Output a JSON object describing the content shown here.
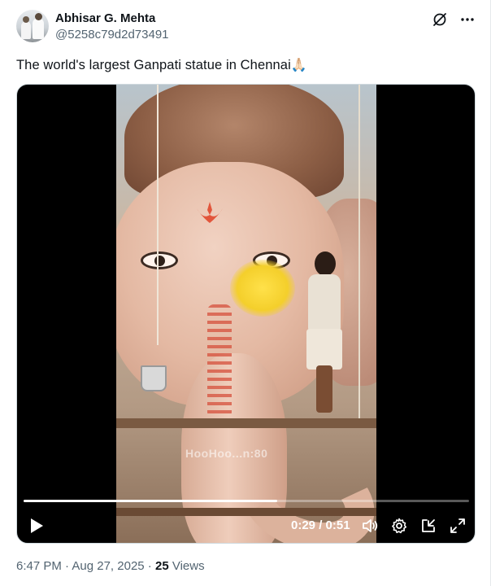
{
  "author": {
    "name": "Abhisar G. Mehta",
    "handle": "@5258c79d2d73491"
  },
  "tweet": {
    "text": "The world's largest Ganpati statue in Chennai",
    "emoji": "🙏🏻"
  },
  "video": {
    "watermark": "HooHoo...n:80",
    "current_time": "0:29",
    "separator": " / ",
    "duration": "0:51",
    "progress": 0.57
  },
  "footer": {
    "time": "6:47 PM",
    "dot1": " · ",
    "date": "Aug 27, 2025",
    "dot2": " · ",
    "views_count": "25",
    "views_label": " Views"
  },
  "icons": {
    "grok": "grok-icon",
    "more": "more-icon",
    "play": "play-icon",
    "volume": "volume-icon",
    "settings": "gear-icon",
    "pip": "picture-in-picture-icon",
    "fullscreen": "fullscreen-icon"
  }
}
